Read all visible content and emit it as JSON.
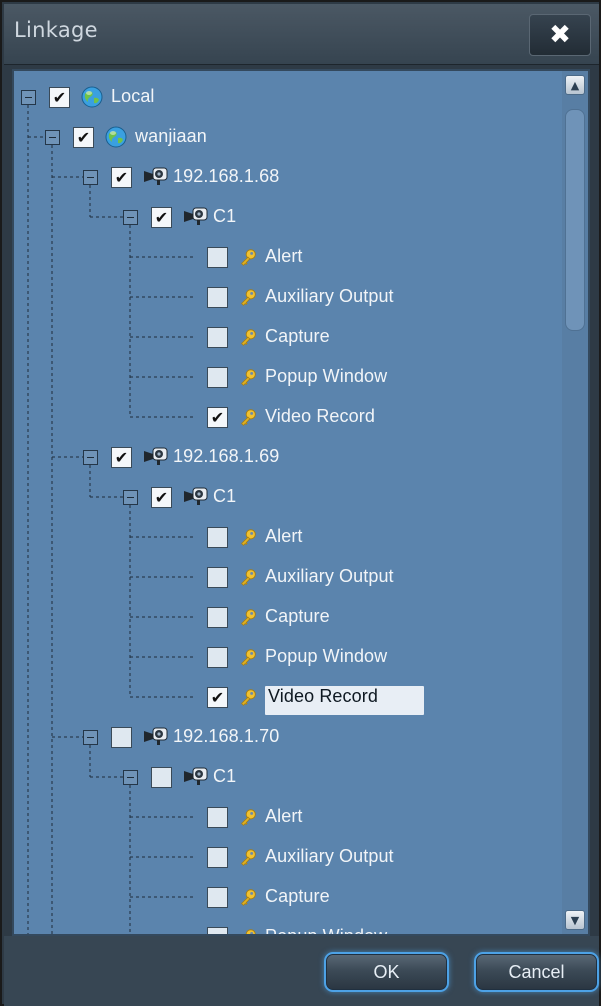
{
  "window": {
    "title": "Linkage",
    "close_glyph": "✖"
  },
  "tree": {
    "root": {
      "label": "Local",
      "checked": true,
      "icon": "globe-icon"
    },
    "site": {
      "label": "wanjiaan",
      "checked": true,
      "icon": "globe-icon"
    },
    "devices": [
      {
        "label": "192.168.1.68",
        "checked": true,
        "channel": {
          "label": "C1",
          "checked": true
        },
        "actions": [
          {
            "label": "Alert",
            "checked": false
          },
          {
            "label": "Auxiliary Output",
            "checked": false
          },
          {
            "label": "Capture",
            "checked": false
          },
          {
            "label": "Popup Window",
            "checked": false
          },
          {
            "label": "Video Record",
            "checked": true
          }
        ]
      },
      {
        "label": "192.168.1.69",
        "checked": true,
        "channel": {
          "label": "C1",
          "checked": true
        },
        "actions": [
          {
            "label": "Alert",
            "checked": false
          },
          {
            "label": "Auxiliary Output",
            "checked": false
          },
          {
            "label": "Capture",
            "checked": false
          },
          {
            "label": "Popup Window",
            "checked": false
          },
          {
            "label": "Video Record",
            "checked": true,
            "selected": true
          }
        ]
      },
      {
        "label": "192.168.1.70",
        "checked": false,
        "channel": {
          "label": "C1",
          "checked": false
        },
        "actions": [
          {
            "label": "Alert",
            "checked": false
          },
          {
            "label": "Auxiliary Output",
            "checked": false
          },
          {
            "label": "Capture",
            "checked": false
          },
          {
            "label": "Popup Window",
            "checked": false
          }
        ]
      }
    ],
    "check_glyph": "✔"
  },
  "footer": {
    "ok_label": "OK",
    "cancel_label": "Cancel"
  },
  "colors": {
    "panel": "#5b84ad",
    "selection": "#e8eef5",
    "button_glow": "#4da2e6"
  }
}
